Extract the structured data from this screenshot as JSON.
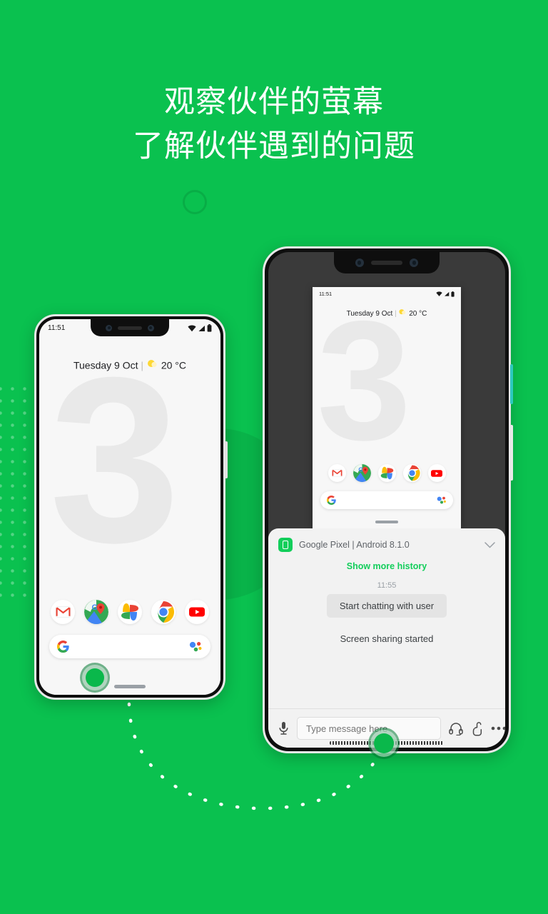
{
  "headline": {
    "line1": "观察伙伴的萤幕",
    "line2": "了解伙伴遇到的问题"
  },
  "colors": {
    "background_green": "#0ac14f",
    "accent_green": "#13ce5b",
    "touch_indicator": "#0ab84b",
    "panel_gray": "#f2f2f2",
    "screen_dark": "#3a3a3a",
    "wallpaper_mark": "#e9e9e9"
  },
  "left_phone": {
    "name": "local-device",
    "status_bar": {
      "time": "11:51",
      "icons": [
        "wifi-icon",
        "signal-icon",
        "battery-icon"
      ]
    },
    "date_strip": {
      "date": "Tuesday 9 Oct",
      "separator": "|",
      "weather_icon": "sun-icon",
      "temperature": "20 °C"
    },
    "wallpaper_mark": "3",
    "dock": [
      {
        "name": "gmail",
        "label": "Gmail"
      },
      {
        "name": "maps",
        "label": "Maps"
      },
      {
        "name": "photos",
        "label": "Photos"
      },
      {
        "name": "chrome",
        "label": "Chrome"
      },
      {
        "name": "youtube",
        "label": "YouTube"
      }
    ],
    "search_bar": {
      "logo": "google-g-icon",
      "assistant": "google-assistant-icon"
    }
  },
  "right_phone": {
    "name": "remote-viewer-device",
    "status_bar": {
      "time": "11:51",
      "icons": [
        "wifi-icon",
        "signal-icon",
        "battery-icon"
      ]
    },
    "mirrored_screen": {
      "date_strip": {
        "date": "Tuesday 9 Oct",
        "separator": "|",
        "weather_icon": "sun-icon",
        "temperature": "20 °C"
      },
      "wallpaper_mark": "3",
      "dock": [
        {
          "name": "gmail",
          "label": "Gmail"
        },
        {
          "name": "maps",
          "label": "Maps"
        },
        {
          "name": "photos",
          "label": "Photos"
        },
        {
          "name": "chrome",
          "label": "Chrome"
        },
        {
          "name": "youtube",
          "label": "YouTube"
        }
      ],
      "search_bar": {
        "logo": "google-g-icon",
        "assistant": "google-assistant-icon"
      }
    },
    "chat_panel": {
      "device_badge_icon": "phone-icon",
      "device_title": "Google Pixel | Android 8.1.0",
      "collapse_icon": "chevron-down-icon",
      "show_more_label": "Show more history",
      "message_time": "11:55",
      "bubble_text": "Start chatting with user",
      "system_message": "Screen sharing started",
      "composer": {
        "mic_icon": "microphone-icon",
        "input_placeholder": "Type message here",
        "input_value": "",
        "headset_icon": "headset-icon",
        "gesture_icon": "pointing-hand-icon",
        "more_icon": "more-horizontal-icon"
      }
    }
  }
}
